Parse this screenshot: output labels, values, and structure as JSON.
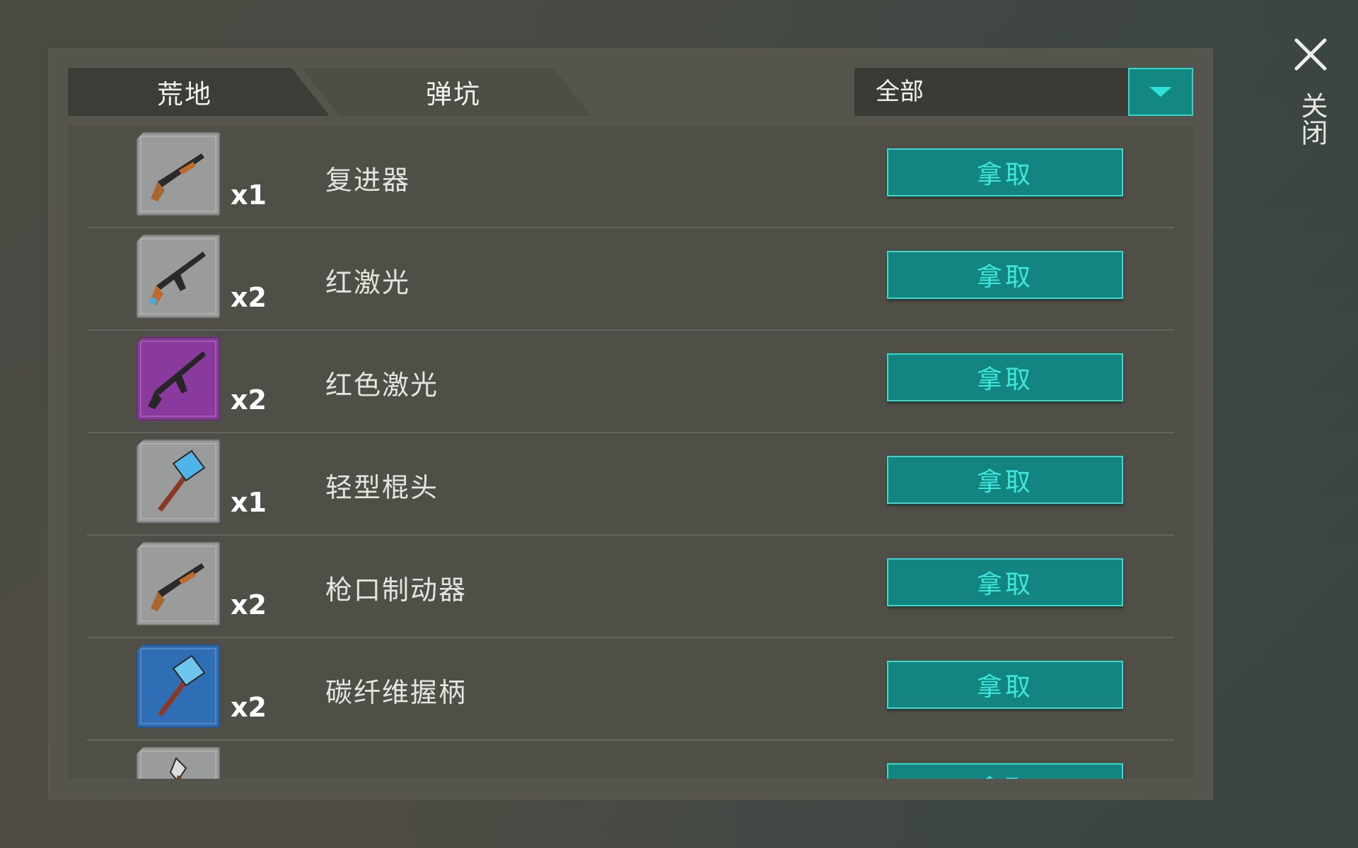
{
  "tabs": [
    {
      "label": "荒地"
    },
    {
      "label": "弹坑"
    }
  ],
  "filter": {
    "selected": "全部",
    "icon": "chevron-down-icon"
  },
  "close": {
    "label": "关闭",
    "icon": "close-icon"
  },
  "items": [
    {
      "name": "复进器",
      "qty": "x1",
      "rarity": "gray",
      "icon": "shotgun-icon",
      "action": "拿取"
    },
    {
      "name": "红激光",
      "qty": "x2",
      "rarity": "gray",
      "icon": "assault-rifle-icon",
      "action": "拿取"
    },
    {
      "name": "红色激光",
      "qty": "x2",
      "rarity": "purple",
      "icon": "rifle-icon",
      "action": "拿取"
    },
    {
      "name": "轻型棍头",
      "qty": "x1",
      "rarity": "gray",
      "icon": "hammer-icon",
      "action": "拿取"
    },
    {
      "name": "枪口制动器",
      "qty": "x2",
      "rarity": "gray",
      "icon": "shotgun-icon",
      "action": "拿取"
    },
    {
      "name": "碳纤维握柄",
      "qty": "x2",
      "rarity": "blue",
      "icon": "hammer-icon",
      "action": "拿取"
    },
    {
      "name": "",
      "qty": "",
      "rarity": "gray",
      "icon": "axe-icon",
      "action": "拿取"
    }
  ],
  "colors": {
    "accent": "#13847f",
    "accent_border": "#38d9cf",
    "rarity_gray": "#9a9c9b",
    "rarity_purple": "#8a3a9c",
    "rarity_blue": "#2f6db5"
  }
}
